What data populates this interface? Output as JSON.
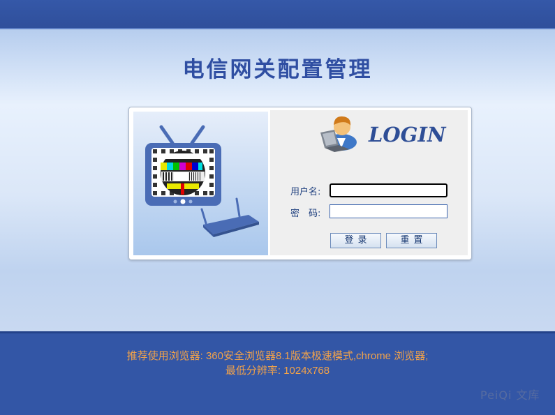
{
  "header": {
    "title": "电信网关配置管理"
  },
  "login": {
    "heading": "LOGIN",
    "username_label": "用户名:",
    "password_label": "密　码:",
    "username_value": "",
    "password_value": "",
    "login_button": "登录",
    "reset_button": "重置"
  },
  "footer": {
    "line1": "推荐使用浏览器: 360安全浏览器8.1版本极速模式,chrome 浏览器;",
    "line2": "最低分辨率: 1024x768",
    "watermark": "PeiQi 文库"
  },
  "icons": [
    "tv-test-pattern-icon",
    "router-icon",
    "user-laptop-icon"
  ],
  "colors": {
    "brand_blue": "#3356a6",
    "title_blue": "#2f4ea2",
    "footer_text": "#f1a24a"
  }
}
